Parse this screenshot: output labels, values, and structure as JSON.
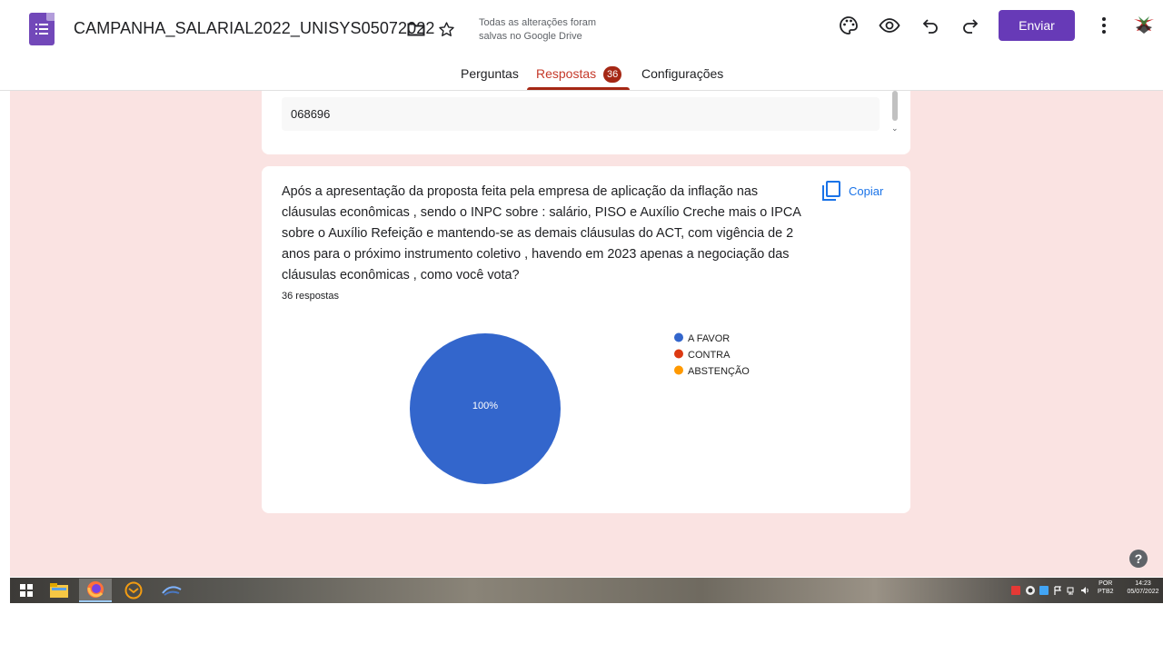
{
  "header": {
    "title": "CAMPANHA_SALARIAL2022_UNISYS05072022",
    "save_status": "Todas as alterações foram salvas no Google Drive",
    "send_label": "Enviar"
  },
  "tabs": [
    {
      "label": "Perguntas"
    },
    {
      "label": "Respostas",
      "badge": "36"
    },
    {
      "label": "Configurações"
    }
  ],
  "previous_answer": "068696",
  "question": {
    "text": "Após a apresentação da proposta feita pela empresa de aplicação da inflação nas cláusulas econômicas , sendo o INPC sobre : salário, PISO e Auxílio Creche mais o IPCA sobre o Auxílio Refeição e mantendo-se as demais cláusulas do ACT, com vigência de 2 anos para o próximo instrumento coletivo , havendo em 2023 apenas a negociação das cláusulas econômicas , como você vota?",
    "response_count": "36 respostas",
    "copy_label": "Copiar"
  },
  "chart_data": {
    "type": "pie",
    "categories": [
      "A FAVOR",
      "CONTRA",
      "ABSTENÇÃO"
    ],
    "values": [
      36,
      0,
      0
    ],
    "colors": [
      "#3366cc",
      "#dc3912",
      "#ff9900"
    ],
    "slice_labels": [
      "100%"
    ],
    "legend": "right"
  },
  "taskbar": {
    "lang_top": "POR",
    "lang_bottom": "PTB2",
    "time": "14:23",
    "date": "05/07/2022"
  }
}
